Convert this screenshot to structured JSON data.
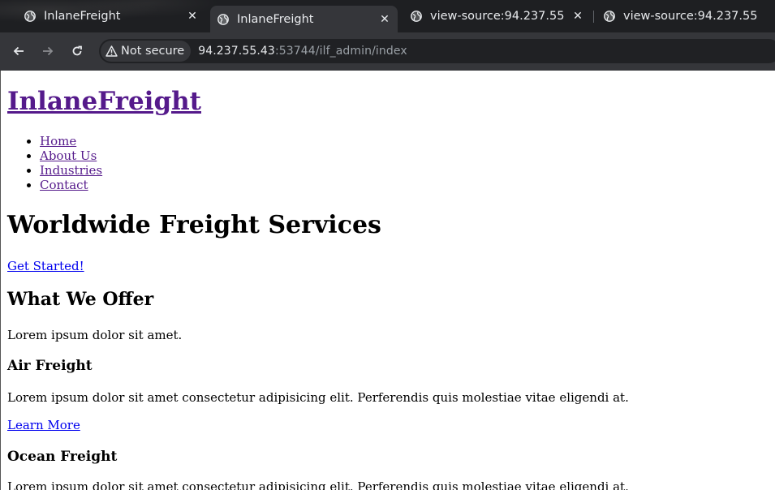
{
  "browser": {
    "tabs": [
      {
        "title": "InlaneFreight",
        "active": false
      },
      {
        "title": "InlaneFreight",
        "active": true
      },
      {
        "title": "view-source:94.237.55",
        "active": false
      },
      {
        "title": "view-source:94.237.55",
        "active": false
      }
    ],
    "close_glyph": "✕",
    "security_label": "Not secure",
    "url_host": "94.237.55.43",
    "url_rest": ":53744/ilf_admin/index"
  },
  "site": {
    "brand": "InlaneFreight",
    "nav": [
      "Home",
      "About Us",
      "Industries",
      "Contact"
    ],
    "hero_title": "Worldwide Freight Services",
    "cta_label": "Get Started!",
    "offer_title": "What We Offer",
    "offer_text": "Lorem ipsum dolor sit amet.",
    "services": [
      {
        "title": "Air Freight",
        "text": "Lorem ipsum dolor sit amet consectetur adipisicing elit. Perferendis quis molestiae vitae eligendi at.",
        "link": "Learn More"
      },
      {
        "title": "Ocean Freight",
        "text": "Lorem ipsum dolor sit amet consectetur adipisicing elit. Perferendis quis molestiae vitae eligendi at."
      }
    ]
  },
  "colors": {
    "link": "#0000ee",
    "visited_link": "#551a8b",
    "chrome_bg": "#35363a"
  }
}
